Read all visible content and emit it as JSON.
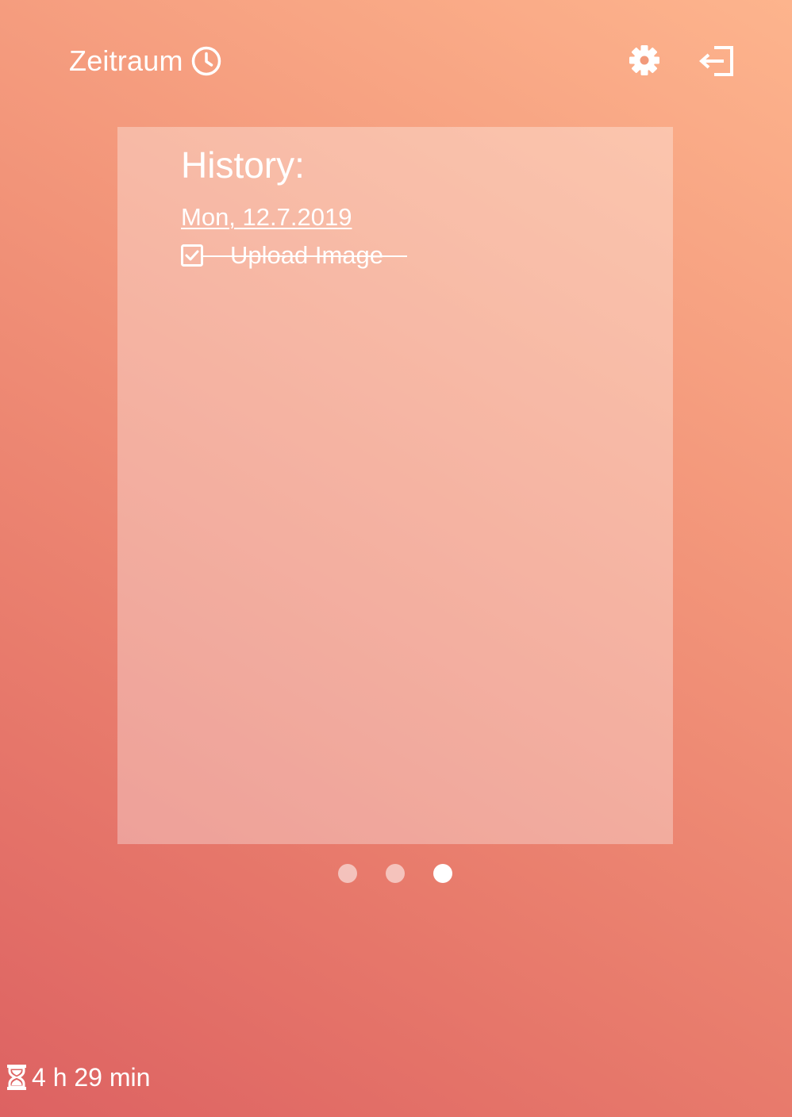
{
  "header": {
    "app_name": "Zeitraum",
    "brand_icon": "clock-icon",
    "settings_icon": "gear-icon",
    "logout_icon": "logout-icon"
  },
  "history": {
    "title": "History:",
    "entries": [
      {
        "date": "Mon, 12.7.2019",
        "tasks": [
          {
            "label": "Upload Image",
            "done": true
          }
        ]
      }
    ]
  },
  "pager": {
    "pages": 3,
    "active_index": 2
  },
  "footer": {
    "remaining_time": "4 h 29 min",
    "timer_icon": "hourglass-icon"
  },
  "colors": {
    "gradient_start": "#dd6262",
    "gradient_end": "#fdb48d",
    "text": "#ffffff"
  }
}
